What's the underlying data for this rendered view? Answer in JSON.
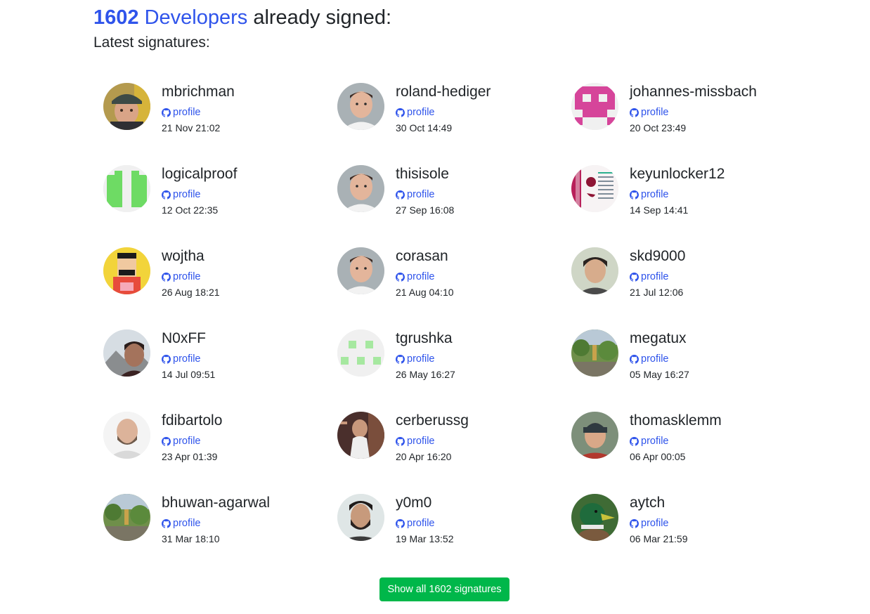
{
  "header": {
    "count": "1602",
    "developers_label": "Developers",
    "signed_label": "already signed:",
    "subtitle": "Latest signatures:"
  },
  "profile_label": "profile",
  "signatures": [
    {
      "name": "mbrichman",
      "date": "21 Nov 21:02",
      "avatar": "photo-man-cap"
    },
    {
      "name": "roland-hediger",
      "date": "30 Oct 14:49",
      "avatar": "photo-man"
    },
    {
      "name": "johannes-missbach",
      "date": "20 Oct 23:49",
      "avatar": "identicon-pink"
    },
    {
      "name": "logicalproof",
      "date": "12 Oct 22:35",
      "avatar": "identicon-green"
    },
    {
      "name": "thisisole",
      "date": "27 Sep 16:08",
      "avatar": "photo-man"
    },
    {
      "name": "keyunlocker12",
      "date": "14 Sep 14:41",
      "avatar": "document-image"
    },
    {
      "name": "wojtha",
      "date": "26 Aug 18:21",
      "avatar": "cartoon-man"
    },
    {
      "name": "corasan",
      "date": "21 Aug 04:10",
      "avatar": "photo-man"
    },
    {
      "name": "skd9000",
      "date": "21 Jul 12:06",
      "avatar": "photo-person"
    },
    {
      "name": "N0xFF",
      "date": "14 Jul 09:51",
      "avatar": "photo-man-mountain"
    },
    {
      "name": "tgrushka",
      "date": "26 May 16:27",
      "avatar": "identicon-lightgreen"
    },
    {
      "name": "megatux",
      "date": "05 May 16:27",
      "avatar": "photo-nature"
    },
    {
      "name": "fdibartolo",
      "date": "23 Apr 01:39",
      "avatar": "photo-man-bald"
    },
    {
      "name": "cerberussg",
      "date": "20 Apr 16:20",
      "avatar": "photo-man-dark"
    },
    {
      "name": "thomasklemm",
      "date": "06 Apr 00:05",
      "avatar": "photo-man-beanie"
    },
    {
      "name": "bhuwan-agarwal",
      "date": "31 Mar 18:10",
      "avatar": "photo-nature"
    },
    {
      "name": "y0m0",
      "date": "19 Mar 13:52",
      "avatar": "photo-man-beard"
    },
    {
      "name": "aytch",
      "date": "06 Mar 21:59",
      "avatar": "photo-duck"
    }
  ],
  "show_all_button": "Show all 1602 signatures",
  "colors": {
    "link": "#2f54eb",
    "button": "#00b74a",
    "text": "#212529"
  }
}
